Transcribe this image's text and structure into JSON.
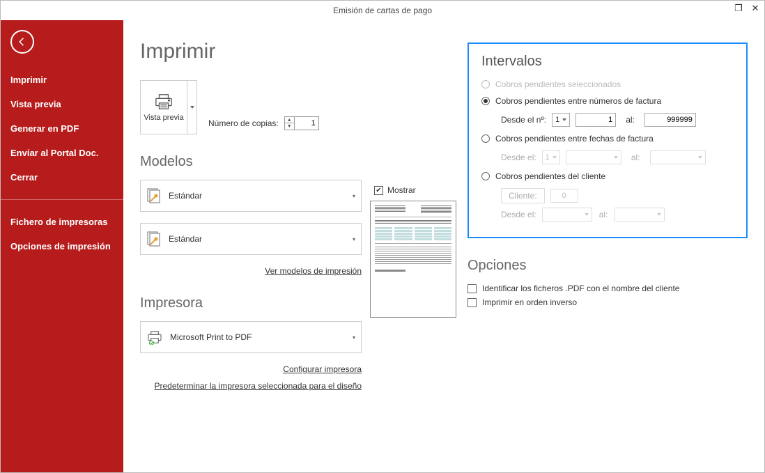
{
  "window": {
    "title": "Emisión de cartas de pago"
  },
  "sidebar": {
    "items": [
      "Imprimir",
      "Vista previa",
      "Generar en PDF",
      "Enviar al Portal Doc.",
      "Cerrar"
    ],
    "items2": [
      "Fichero de impresoras",
      "Opciones de impresión"
    ]
  },
  "header": {
    "title": "Imprimir"
  },
  "vistaPrevia": {
    "label": "Vista previa"
  },
  "copies": {
    "label": "Número de copias:",
    "value": "1"
  },
  "modelos": {
    "title": "Modelos",
    "combo1": "Estándar",
    "combo2": "Estándar",
    "link": "Ver modelos de impresión"
  },
  "impresora": {
    "title": "Impresora",
    "name": "Microsoft Print to PDF",
    "link1": "Configurar impresora",
    "link2": "Predeterminar la impresora seleccionada para el diseño"
  },
  "preview": {
    "mostrar": "Mostrar",
    "checked": true
  },
  "intervalos": {
    "title": "Intervalos",
    "opt1": "Cobros pendientes seleccionados",
    "opt2": "Cobros pendientes entre números de factura",
    "opt2_from_label": "Desde el nº:",
    "opt2_series": "1",
    "opt2_from": "1",
    "opt2_to_label": "al:",
    "opt2_to": "999999",
    "opt3": "Cobros pendientes entre fechas de factura",
    "opt3_from_label": "Desde el:",
    "opt3_series": "1",
    "opt3_to_label": "al:",
    "opt4": "Cobros pendientes del cliente",
    "opt4_cliente": "Cliente:",
    "opt4_cliente_val": "0",
    "opt4_from_label": "Desde el:",
    "opt4_to_label": "al:"
  },
  "opciones": {
    "title": "Opciones",
    "chk1": "Identificar los ficheros .PDF con el nombre del cliente",
    "chk2": "Imprimir en orden inverso"
  }
}
